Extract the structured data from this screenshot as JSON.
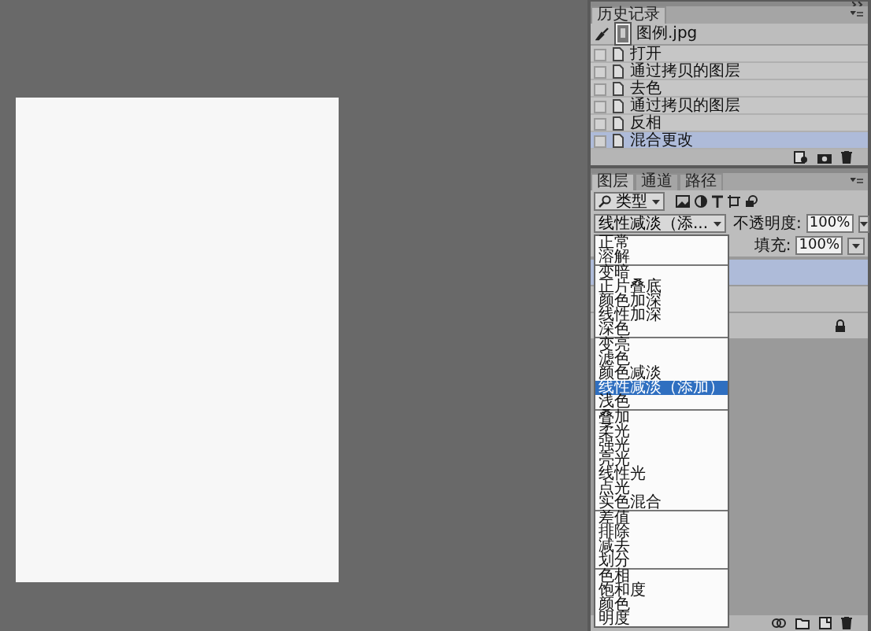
{
  "history": {
    "tab": "历史记录",
    "snapshot": {
      "name": "图例.jpg"
    },
    "steps": [
      {
        "label": "打开",
        "selected": false
      },
      {
        "label": "通过拷贝的图层",
        "selected": false
      },
      {
        "label": "去色",
        "selected": false
      },
      {
        "label": "通过拷贝的图层",
        "selected": false
      },
      {
        "label": "反相",
        "selected": false
      },
      {
        "label": "混合更改",
        "selected": true
      }
    ]
  },
  "layers": {
    "tabs": [
      {
        "label": "图层",
        "selected": true
      },
      {
        "label": "通道",
        "selected": false
      },
      {
        "label": "路径",
        "selected": false
      }
    ],
    "filter": {
      "value": "类型"
    },
    "blend_mode": {
      "value": "线性减淡（添..."
    },
    "opacity": {
      "label": "不透明度:",
      "value": "100%"
    },
    "fill": {
      "label": "填充:",
      "value": "100%"
    },
    "items": [
      {
        "selected": true,
        "locked": false
      },
      {
        "selected": false,
        "locked": false
      },
      {
        "selected": false,
        "locked": true
      }
    ]
  },
  "blend_menu": {
    "groups": [
      {
        "items": [
          {
            "label": "正常",
            "selected": false
          },
          {
            "label": "溶解",
            "selected": false
          }
        ]
      },
      {
        "items": [
          {
            "label": "变暗",
            "selected": false
          },
          {
            "label": "正片叠底",
            "selected": false
          },
          {
            "label": "颜色加深",
            "selected": false
          },
          {
            "label": "线性加深",
            "selected": false
          },
          {
            "label": "深色",
            "selected": false
          }
        ]
      },
      {
        "items": [
          {
            "label": "变亮",
            "selected": false
          },
          {
            "label": "滤色",
            "selected": false
          },
          {
            "label": "颜色减淡",
            "selected": false
          },
          {
            "label": "线性减淡（添加）",
            "selected": true
          },
          {
            "label": "浅色",
            "selected": false
          }
        ]
      },
      {
        "items": [
          {
            "label": "叠加",
            "selected": false
          },
          {
            "label": "柔光",
            "selected": false
          },
          {
            "label": "强光",
            "selected": false
          },
          {
            "label": "亮光",
            "selected": false
          },
          {
            "label": "线性光",
            "selected": false
          },
          {
            "label": "点光",
            "selected": false
          },
          {
            "label": "实色混合",
            "selected": false
          }
        ]
      },
      {
        "items": [
          {
            "label": "差值",
            "selected": false
          },
          {
            "label": "排除",
            "selected": false
          },
          {
            "label": "减去",
            "selected": false
          },
          {
            "label": "划分",
            "selected": false
          }
        ]
      },
      {
        "items": [
          {
            "label": "色相",
            "selected": false
          },
          {
            "label": "饱和度",
            "selected": false
          },
          {
            "label": "颜色",
            "selected": false
          },
          {
            "label": "明度",
            "selected": false
          }
        ]
      }
    ]
  }
}
